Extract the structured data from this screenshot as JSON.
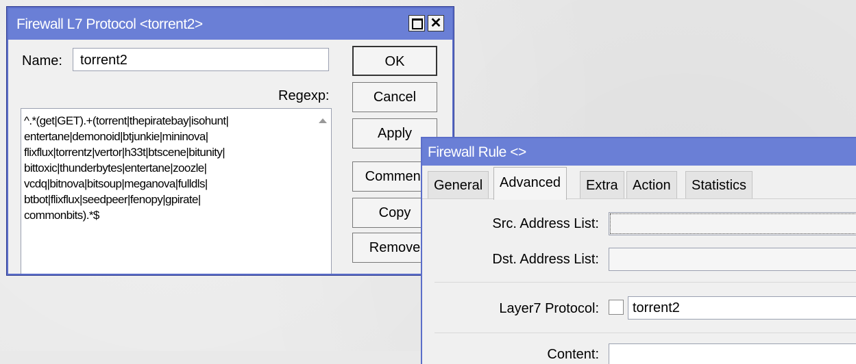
{
  "l7_window": {
    "title": "Firewall L7 Protocol <torrent2>",
    "name_label": "Name:",
    "name_value": "torrent2",
    "regexp_label": "Regexp:",
    "regexp_value": "^.*(get|GET).+(torrent|thepiratebay|isohunt|\nentertane|demonoid|btjunkie|mininova|\nflixflux|torrentz|vertor|h33t|btscene|bitunity|\nbittoxic|thunderbytes|entertane|zoozle|\nvcdq|bitnova|bitsoup|meganova|fulldls|\nbtbot|flixflux|seedpeer|fenopy|gpirate|\ncommonbits).*$",
    "buttons": {
      "ok": "OK",
      "cancel": "Cancel",
      "apply": "Apply",
      "comment": "Comment",
      "copy": "Copy",
      "remove": "Remove"
    }
  },
  "rule_window": {
    "title": "Firewall Rule <>",
    "tabs": [
      {
        "label": "General"
      },
      {
        "label": "Advanced"
      },
      {
        "label": "Extra"
      },
      {
        "label": "Action"
      },
      {
        "label": "Statistics"
      }
    ],
    "active_tab": "Advanced",
    "fields": {
      "src_address_list_label": "Src. Address List:",
      "dst_address_list_label": "Dst. Address List:",
      "layer7_label": "Layer7 Protocol:",
      "layer7_value": "torrent2",
      "content_label": "Content:"
    }
  },
  "colors": {
    "titlebar": "#6a7fd6",
    "window_bg": "#f0f0f0"
  }
}
